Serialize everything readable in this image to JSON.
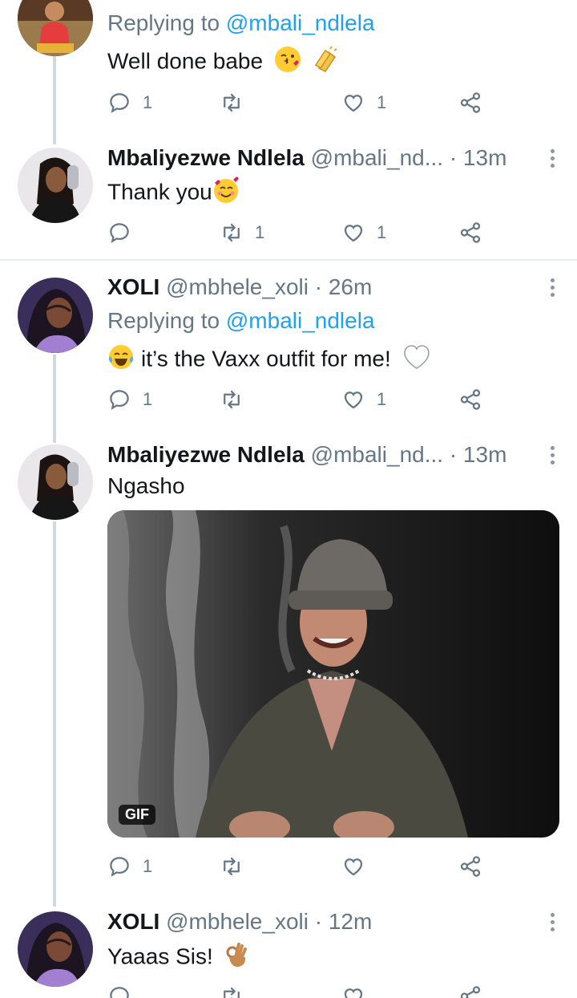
{
  "tweets": [
    {
      "reply_prefix": "Replying to ",
      "reply_to": "@mbali_ndlela",
      "text": "Well done babe",
      "emoji": [
        "kissing-face-heart-emoji",
        "clapping-hands-emoji"
      ],
      "replies": "1",
      "retweets": "",
      "likes": "1"
    },
    {
      "name": "Mbaliyezwe Ndlela",
      "handle": "@mbali_nd...",
      "time": "· 13m",
      "text": "Thank you",
      "emoji": [
        "smiling-face-hearts-emoji"
      ],
      "replies": "",
      "retweets": "1",
      "likes": "1"
    },
    {
      "name": "XOLI",
      "handle": "@mbhele_xoli",
      "time": "· 26m",
      "reply_prefix": "Replying to ",
      "reply_to": "@mbali_ndlela",
      "text": "it’s the Vaxx outfit for me!",
      "emoji": [
        "tears-of-joy-emoji",
        "white-heart-emoji"
      ],
      "replies": "1",
      "retweets": "",
      "likes": "1"
    },
    {
      "name": "Mbaliyezwe Ndlela",
      "handle": "@mbali_nd...",
      "time": "· 13m",
      "text": "Ngasho",
      "media_badge": "GIF",
      "replies": "1",
      "retweets": "",
      "likes": ""
    },
    {
      "name": "XOLI",
      "handle": "@mbhele_xoli",
      "time": "· 12m",
      "text": "Yaaas Sis!",
      "emoji": [
        "ok-hand-emoji"
      ]
    }
  ],
  "colors": {
    "accent": "#1da1f2",
    "secondary_text": "#657786",
    "divider": "#e6ecf0",
    "thread_line": "#cfd9de"
  },
  "icons": [
    "reply-icon",
    "retweet-icon",
    "like-icon",
    "share-icon",
    "more-icon"
  ]
}
